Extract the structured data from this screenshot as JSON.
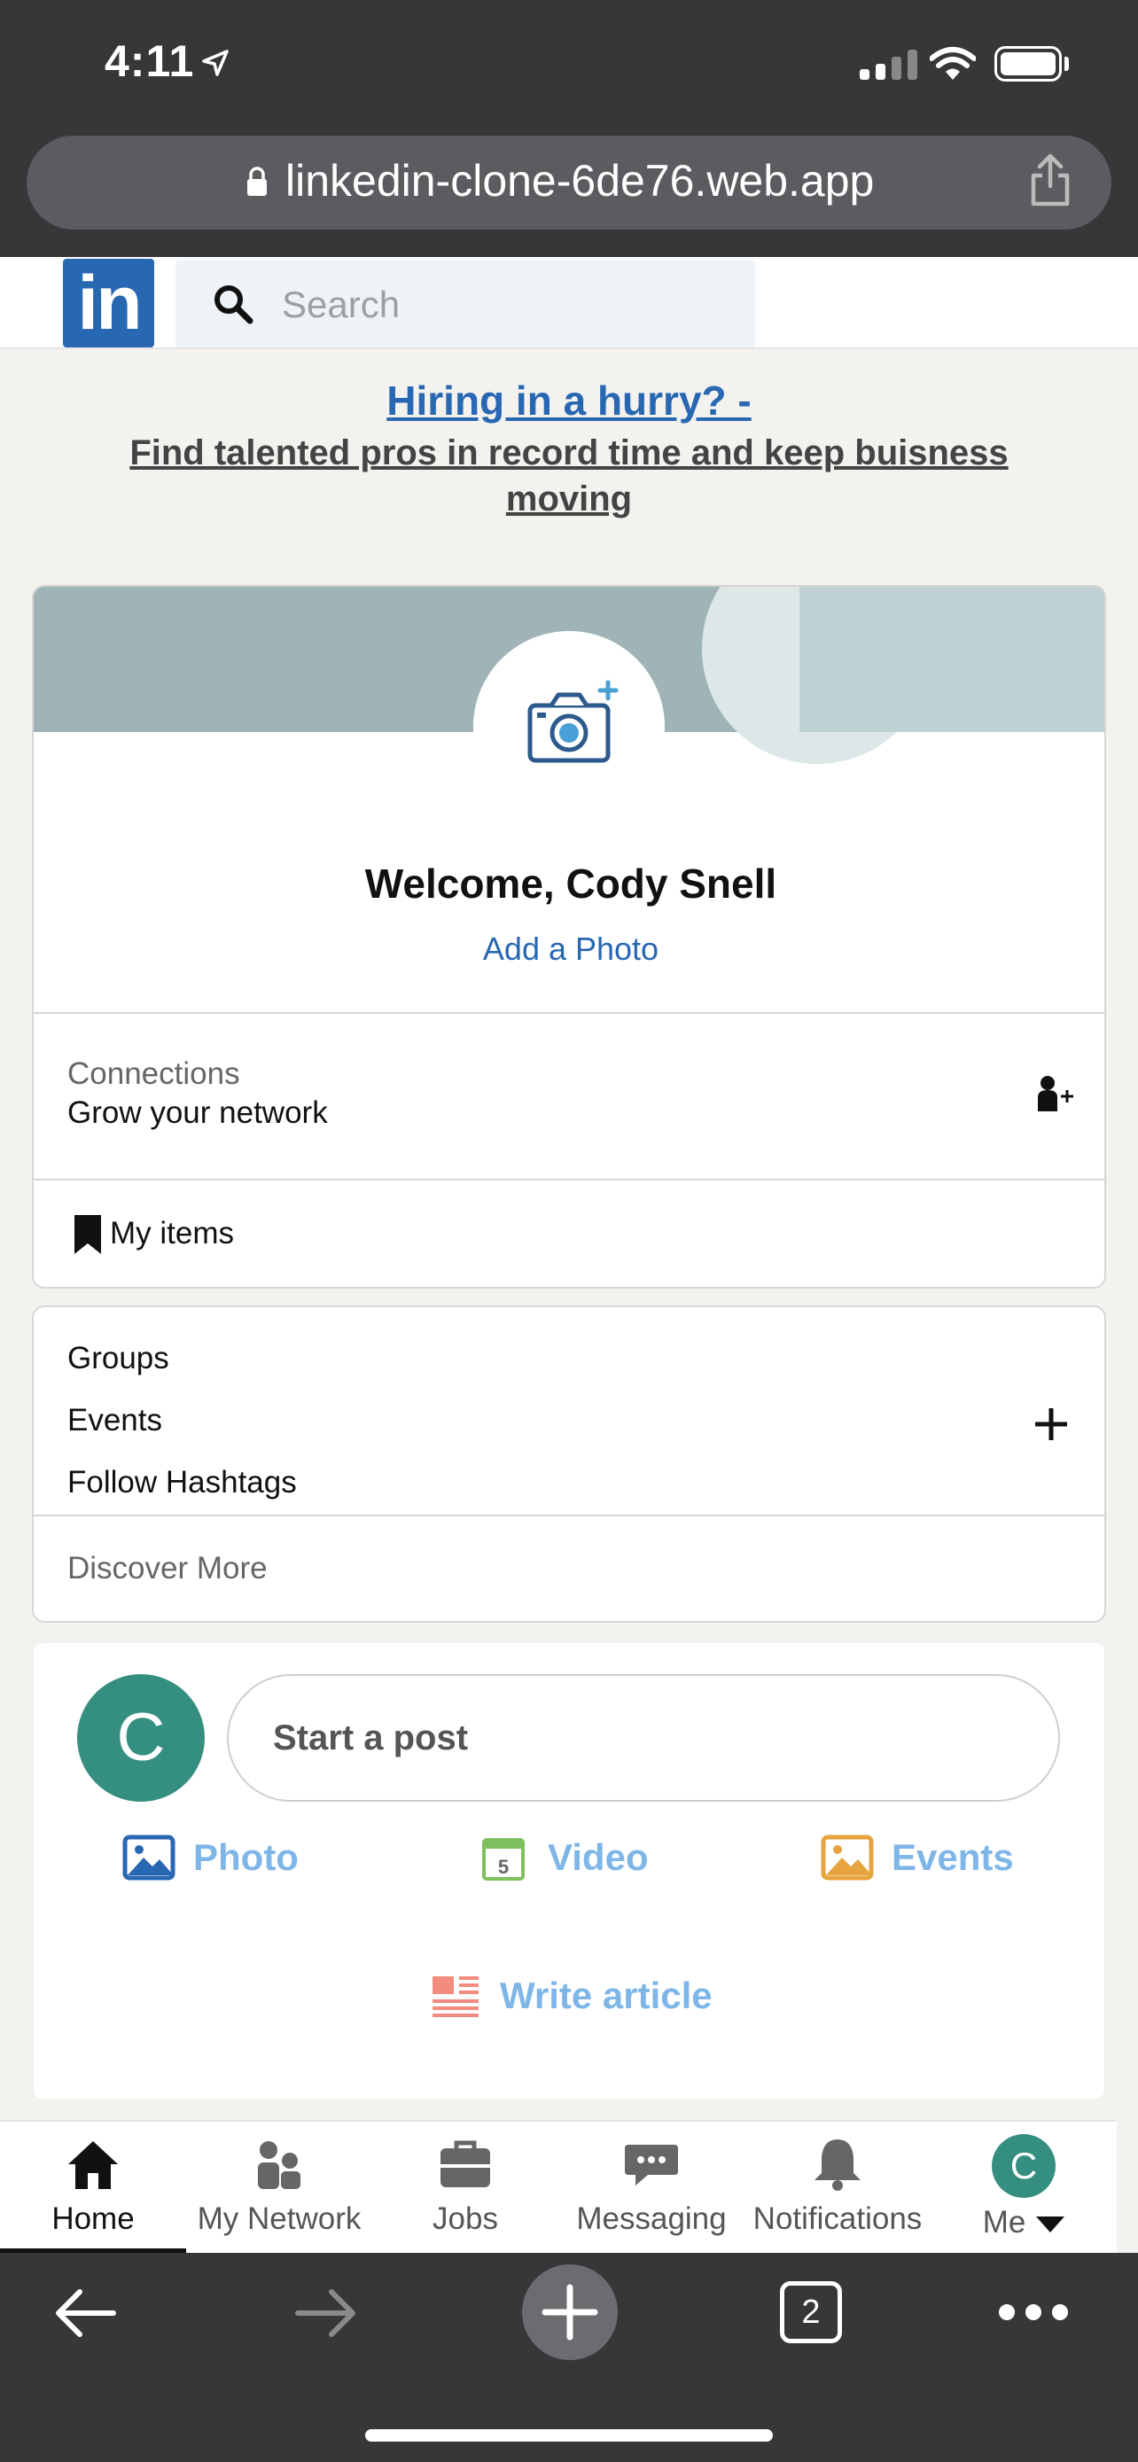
{
  "status_bar": {
    "time": "4:11"
  },
  "browser": {
    "url": "linkedin-clone-6de76.web.app",
    "tab_count": "2"
  },
  "header": {
    "logo_text": "in",
    "search_placeholder": "Search"
  },
  "promo": {
    "title": "Hiring in a hurry? -",
    "body": " Find talented pros in record time and keep buisness moving"
  },
  "profile": {
    "welcome": "Welcome, Cody Snell",
    "add_photo": "Add a Photo",
    "connections_label": "Connections",
    "connections_sub": "Grow your network",
    "my_items": "My items"
  },
  "groups": {
    "items": [
      "Groups",
      "Events",
      "Follow Hashtags"
    ],
    "discover": "Discover More"
  },
  "post": {
    "avatar_initial": "C",
    "start_post": "Start a post",
    "actions": [
      {
        "label": "Photo",
        "icon": "photo-icon",
        "color": "#2867b2"
      },
      {
        "label": "Video",
        "icon": "video-icon",
        "color": "#7fc15e"
      },
      {
        "label": "Events",
        "icon": "events-icon",
        "color": "#e7a33e"
      },
      {
        "label": "Write article",
        "icon": "article-icon",
        "color": "#fc9295"
      }
    ]
  },
  "bottom_nav": {
    "items": [
      {
        "label": "Home",
        "icon": "home-icon",
        "active": true
      },
      {
        "label": "My Network",
        "icon": "network-icon"
      },
      {
        "label": "Jobs",
        "icon": "jobs-icon"
      },
      {
        "label": "Messaging",
        "icon": "messaging-icon"
      },
      {
        "label": "Notifications",
        "icon": "notifications-icon"
      },
      {
        "label": "Me",
        "icon": "me-avatar",
        "initial": "C"
      }
    ]
  },
  "colors": {
    "brand": "#2867b2",
    "avatar": "#358f80",
    "chrome": "#363739"
  }
}
